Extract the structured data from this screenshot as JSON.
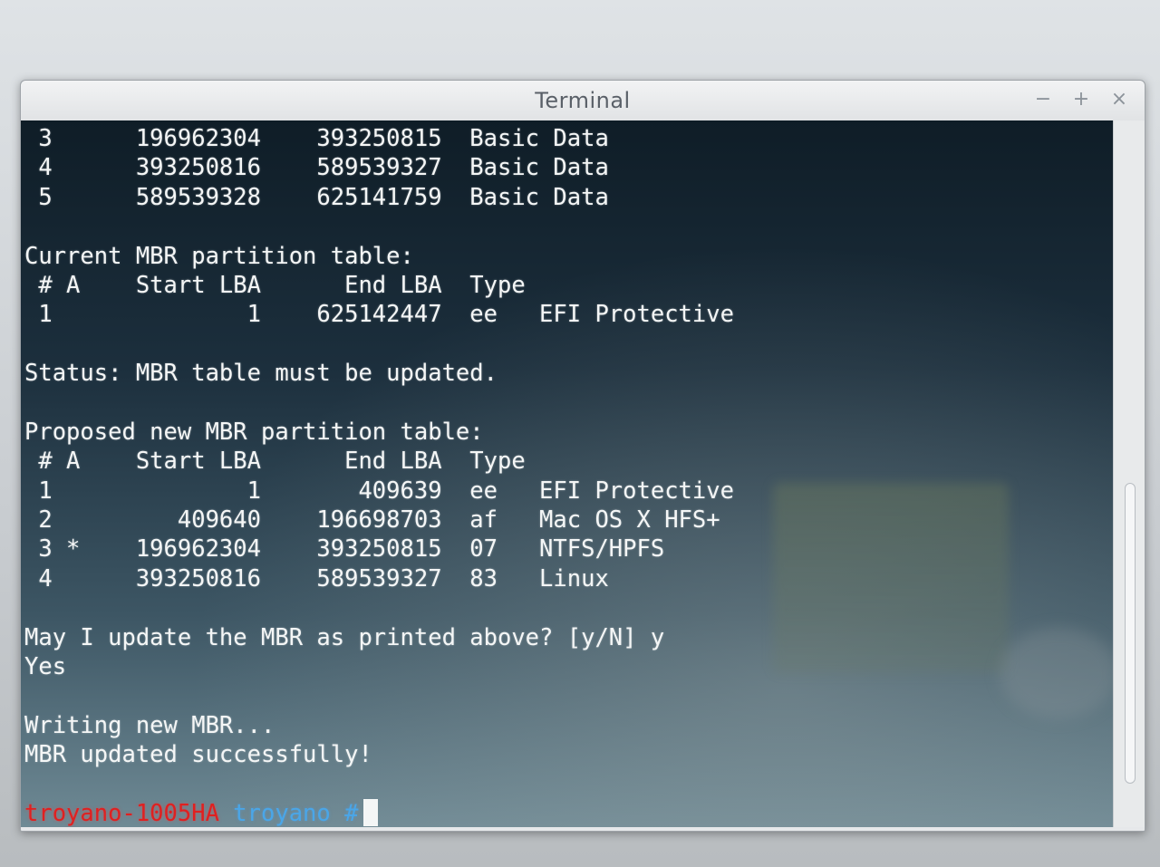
{
  "window": {
    "title": "Terminal",
    "buttons": {
      "minimize": "−",
      "maximize": "+",
      "close": "×"
    }
  },
  "terminal": {
    "lines": [
      " 3      196962304    393250815  Basic Data",
      " 4      393250816    589539327  Basic Data",
      " 5      589539328    625141759  Basic Data",
      "",
      "Current MBR partition table:",
      " # A    Start LBA      End LBA  Type",
      " 1              1    625142447  ee   EFI Protective",
      "",
      "Status: MBR table must be updated.",
      "",
      "Proposed new MBR partition table:",
      " # A    Start LBA      End LBA  Type",
      " 1              1       409639  ee   EFI Protective",
      " 2         409640    196698703  af   Mac OS X HFS+",
      " 3 *    196962304    393250815  07   NTFS/HPFS",
      " 4      393250816    589539327  83   Linux",
      "",
      "May I update the MBR as printed above? [y/N] y",
      "Yes",
      "",
      "Writing new MBR...",
      "MBR updated successfully!",
      ""
    ],
    "prompt": {
      "host": "troyano-1005HA",
      "dir": "troyano #"
    }
  },
  "colors": {
    "prompt_host": "#e02020",
    "prompt_dir": "#4aa6e8",
    "text": "#f4f6f6"
  }
}
